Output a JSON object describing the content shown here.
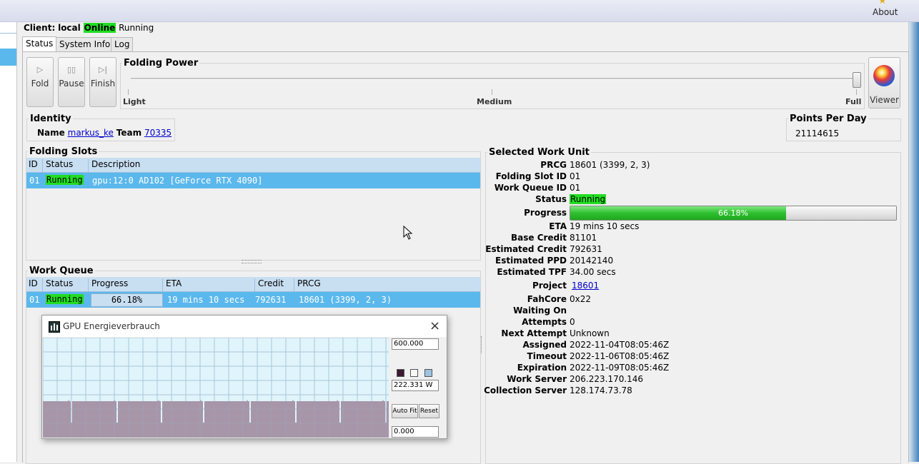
{
  "top": {
    "about_label": "About"
  },
  "client": {
    "prefix": "Client:",
    "name": "local",
    "online": "Online",
    "state": "Running"
  },
  "tabs": [
    {
      "label": "Status"
    },
    {
      "label": "System Info"
    },
    {
      "label": "Log"
    }
  ],
  "toolbar": {
    "fold": "Fold",
    "pause": "Pause",
    "finish": "Finish",
    "viewer": "Viewer"
  },
  "folding_power": {
    "title": "Folding Power",
    "light": "Light",
    "medium": "Medium",
    "full": "Full",
    "level": 1.0
  },
  "identity": {
    "title": "Identity",
    "name_label": "Name",
    "name": "markus_ke",
    "team_label": "Team",
    "team": "70335"
  },
  "ppd": {
    "title": "Points Per Day",
    "value": "21114615"
  },
  "folding_slots": {
    "title": "Folding Slots",
    "columns": [
      "ID",
      "Status",
      "Description"
    ],
    "rows": [
      {
        "id": "01",
        "status": "Running",
        "description": "gpu:12:0 AD102 [GeForce RTX 4090]"
      }
    ]
  },
  "work_queue": {
    "title": "Work Queue",
    "columns": [
      "ID",
      "Status",
      "Progress",
      "ETA",
      "Credit",
      "PRCG"
    ],
    "rows": [
      {
        "id": "01",
        "status": "Running",
        "progress": "66.18%",
        "eta": "19 mins 10 secs",
        "credit": "792631",
        "prcg": "18601 (3399, 2, 3)"
      }
    ]
  },
  "work_unit": {
    "title": "Selected Work Unit",
    "prcg_label": "PRCG",
    "prcg": "18601 (3399, 2, 3)",
    "slot_label": "Folding Slot ID",
    "slot": "01",
    "queue_label": "Work Queue ID",
    "queue": "01",
    "status_label": "Status",
    "status": "Running",
    "progress_label": "Progress",
    "progress": "66.18%",
    "progress_fraction": 0.6618,
    "eta_label": "ETA",
    "eta": "19 mins 10 secs",
    "base_label": "Base Credit",
    "base": "81101",
    "est_credit_label": "Estimated Credit",
    "est_credit": "792631",
    "est_ppd_label": "Estimated PPD",
    "est_ppd": "20142140",
    "est_tpf_label": "Estimated TPF",
    "est_tpf": "34.00 secs",
    "project_label": "Project",
    "project": "18601",
    "fahcore_label": "FahCore",
    "fahcore": "0x22",
    "waiting_label": "Waiting On",
    "waiting": "",
    "attempts_label": "Attempts",
    "attempts": "0",
    "next_label": "Next Attempt",
    "next": "Unknown",
    "assigned_label": "Assigned",
    "assigned": "2022-11-04T08:05:46Z",
    "timeout_label": "Timeout",
    "timeout": "2022-11-06T08:05:46Z",
    "expiration_label": "Expiration",
    "expiration": "2022-11-09T08:05:46Z",
    "ws_label": "Work Server",
    "ws": "206.223.170.146",
    "cs_label": "Collection Server",
    "cs": "128.174.73.78"
  },
  "gpu_window": {
    "title": "GPU Energieverbrauch",
    "max": "600.000",
    "current": "222.331 W",
    "min": "0.000",
    "autofit": "Auto Fit",
    "reset": "Reset",
    "colors": {
      "fill": "#a796a8",
      "plot_bg": "#e0f4fb",
      "grid": "#a9c6d8",
      "line": "#2a1a30"
    }
  },
  "colors": {
    "running": "#22dd22",
    "selection": "#5bb8ec",
    "header": "#c8dff2",
    "progress": "#35c935"
  }
}
